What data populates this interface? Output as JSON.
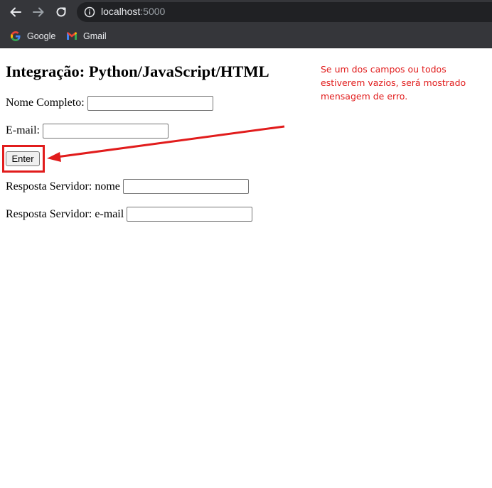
{
  "browser": {
    "url_host": "localhost",
    "url_port": ":5000",
    "bookmarks": [
      {
        "label": "Google",
        "icon": "google-icon"
      },
      {
        "label": "Gmail",
        "icon": "gmail-icon"
      }
    ]
  },
  "page": {
    "title": "Integração: Python/JavaScript/HTML",
    "fields": [
      {
        "label": "Nome Completo:",
        "value": ""
      },
      {
        "label": "E-mail:",
        "value": ""
      }
    ],
    "enter_button": "Enter",
    "responses": [
      {
        "label": "Resposta Servidor: nome",
        "value": ""
      },
      {
        "label": "Resposta Servidor: e-mail",
        "value": ""
      }
    ]
  },
  "annotation": {
    "note": "Se um dos campos ou todos estiverem vazios, será mostrado mensagem de erro.",
    "color": "#e11c1c"
  }
}
